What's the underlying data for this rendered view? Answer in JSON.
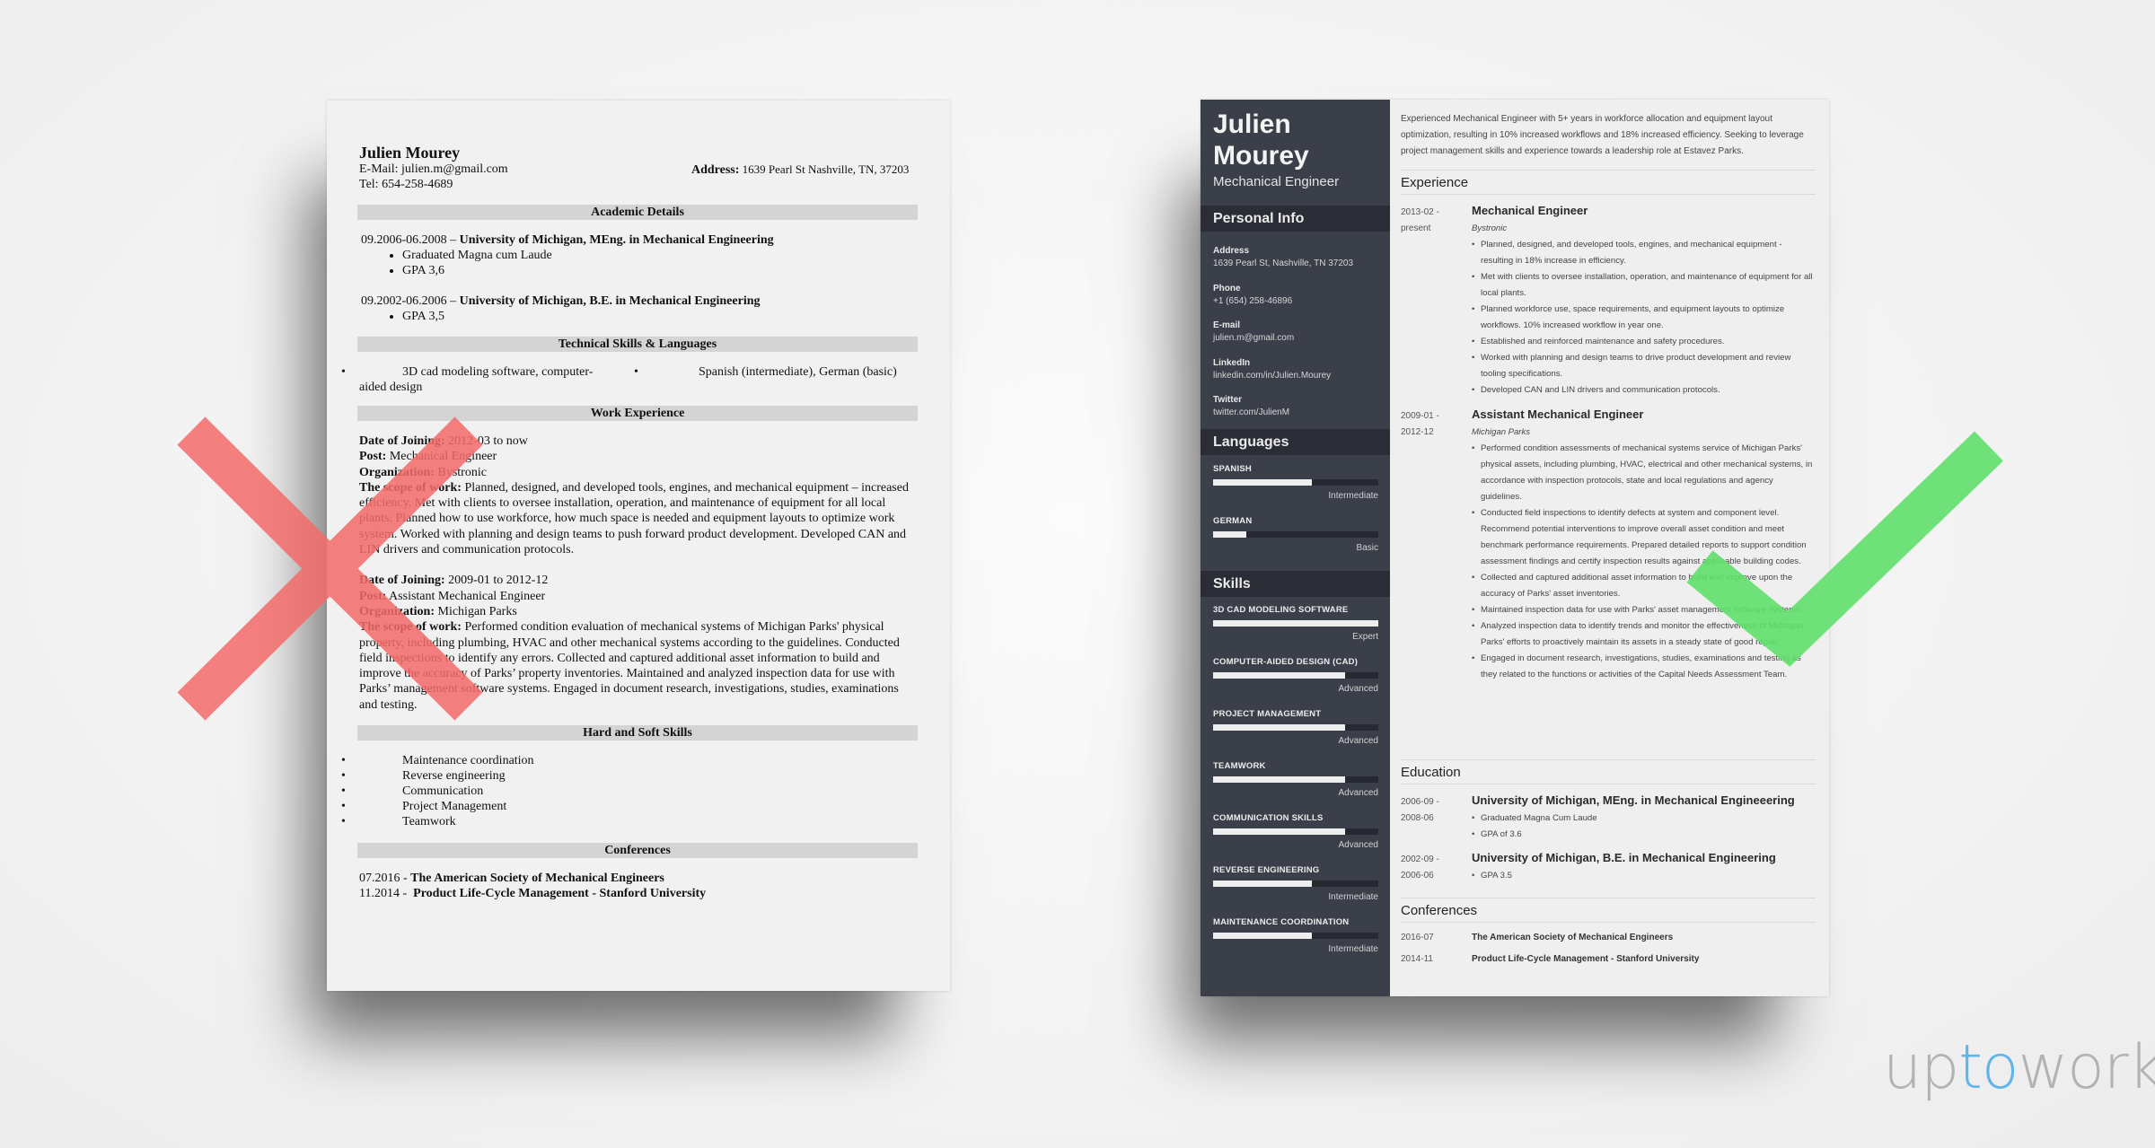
{
  "bad_resume": {
    "name": "Julien Mourey",
    "email": "E-Mail: julien.m@gmail.com",
    "tel": "Tel: 654-258-4689",
    "address_label": "Address:",
    "address_value": "1639 Pearl St Nashville, TN, 37203",
    "sections": {
      "academic": "Academic Details",
      "technical": "Technical Skills & Languages",
      "work": "Work Experience",
      "skills": "Hard and Soft Skills",
      "conferences": "Conferences"
    },
    "education": [
      {
        "dates": "09.2006-06.2008 – ",
        "title": "University of Michigan, MEng. in Mechanical Engineering",
        "bullets": [
          "Graduated Magna cum Laude",
          "GPA 3,6"
        ]
      },
      {
        "dates": "09.2002-06.2006 – ",
        "title": "University of Michigan, B.E. in Mechanical Engineering",
        "bullets": [
          "GPA 3,5"
        ]
      }
    ],
    "technical": [
      "3D cad modeling software, computer-aided design",
      "Spanish (intermediate), German (basic)"
    ],
    "work": [
      {
        "date_label": "Date of Joining:",
        "date": " 2012-03 to now",
        "post_label": "Post:",
        "post": " Mechanical Engineer",
        "org_label": "Organization:",
        "org": " Bystronic",
        "scope_label": "The scope of work:",
        "scope": " Planned, designed, and developed tools, engines, and mechanical equipment – increased efficiency. Met with clients to oversee installation, operation, and maintenance of equipment for all local plants. Planned how to use workforce, how much space is needed and equipment layouts to optimize work system. Worked with planning and design teams to push forward product development. Developed CAN and LIN drivers and communication protocols."
      },
      {
        "date_label": "Date of Joining:",
        "date": " 2009-01 to 2012-12",
        "post_label": "Post:",
        "post": " Assistant Mechanical Engineer",
        "org_label": "Organization:",
        "org": " Michigan Parks",
        "scope_label": "The scope of work:",
        "scope": " Performed condition evaluation of mechanical systems of Michigan Parks' physical property, including plumbing, HVAC and other mechanical systems according to the guidelines. Conducted field inspections to identify any errors. Collected and captured additional asset information to build and improve the accuracy of Parks’ property inventories. Maintained and analyzed inspection data for use with Parks’ management software systems. Engaged in document research, investigations, studies, examinations and testing."
      }
    ],
    "skills": [
      "Maintenance coordination",
      "Reverse engineering",
      "Communication",
      "Project Management",
      "Teamwork"
    ],
    "conferences": [
      {
        "date": "07.2016 - ",
        "title": "The American Society of Mechanical Engineers"
      },
      {
        "date": "11.2014 -  ",
        "title": "Product Life-Cycle Management - Stanford University"
      }
    ]
  },
  "good_resume": {
    "first_name": "Julien",
    "last_name": "Mourey",
    "job_title": "Mechanical Engineer",
    "personal_info_heading": "Personal Info",
    "personal_info": [
      {
        "label": "Address",
        "value": "1639 Pearl St, Nashville, TN 37203"
      },
      {
        "label": "Phone",
        "value": "+1 (654) 258-46896"
      },
      {
        "label": "E-mail",
        "value": "julien.m@gmail.com"
      },
      {
        "label": "LinkedIn",
        "value": "linkedin.com/in/Julien.Mourey"
      },
      {
        "label": "Twitter",
        "value": "twitter.com/JulienM"
      }
    ],
    "languages_heading": "Languages",
    "languages": [
      {
        "name": "SPANISH",
        "level": "Intermediate",
        "fraction": 0.6
      },
      {
        "name": "GERMAN",
        "level": "Basic",
        "fraction": 0.2
      }
    ],
    "skills_heading": "Skills",
    "skills": [
      {
        "name": "3D CAD MODELING SOFTWARE",
        "level": "Expert",
        "fraction": 1.0
      },
      {
        "name": "COMPUTER-AIDED DESIGN (CAD)",
        "level": "Advanced",
        "fraction": 0.8
      },
      {
        "name": "PROJECT MANAGEMENT",
        "level": "Advanced",
        "fraction": 0.8
      },
      {
        "name": "TEAMWORK",
        "level": "Advanced",
        "fraction": 0.8
      },
      {
        "name": "COMMUNICATION SKILLS",
        "level": "Advanced",
        "fraction": 0.8
      },
      {
        "name": "REVERSE ENGINEERING",
        "level": "Intermediate",
        "fraction": 0.6
      },
      {
        "name": "MAINTENANCE COORDINATION",
        "level": "Intermediate",
        "fraction": 0.6
      }
    ],
    "summary": "Experienced Mechanical Engineer with 5+ years in workforce allocation and equipment layout optimization, resulting in 10% increased workflows and 18% increased efficiency. Seeking to leverage project management skills and experience towards a leadership role at Estavez Parks.",
    "experience_heading": "Experience",
    "experience": [
      {
        "dates": "2013-02 - present",
        "role": "Mechanical Engineer",
        "org": "Bystronic",
        "bullets": [
          "Planned, designed, and developed tools, engines, and mechanical equipment - resulting in 18% increase in efficiency.",
          "Met with clients to oversee installation, operation, and maintenance of equipment for all local plants.",
          "Planned workforce use, space requirements, and equipment layouts to optimize workflows. 10% increased workflow in year one.",
          "Established and reinforced maintenance and safety procedures.",
          "Worked with planning and design teams to drive product development and review tooling specifications.",
          "Developed CAN and LIN drivers and communication protocols."
        ]
      },
      {
        "dates": "2009-01 - 2012-12",
        "role": "Assistant Mechanical Engineer",
        "org": "Michigan Parks",
        "bullets": [
          "Performed condition assessments of mechanical systems service of Michigan Parks' physical assets, including plumbing, HVAC, electrical and other mechanical systems, in accordance with inspection protocols, state and local regulations and agency guidelines.",
          "Conducted field inspections to identify defects at system and component level. Recommend potential interventions to improve overall asset condition and meet benchmark performance requirements. Prepared detailed reports to support condition assessment findings and certify inspection results against applicable building codes.",
          "Collected and captured additional asset information to build and improve upon the accuracy of Parks' asset inventories.",
          "Maintained inspection data for use with Parks' asset management software systems.",
          "Analyzed inspection data to identify trends and monitor the effectiveness of Michigan Parks' efforts to proactively maintain its assets in a steady state of good repair.",
          "Engaged in document research, investigations, studies, examinations and testing as they related to the functions or activities of the Capital Needs Assessment Team."
        ]
      }
    ],
    "education_heading": "Education",
    "education": [
      {
        "dates": "2006-09 - 2008-06",
        "title": "University of Michigan, MEng. in Mechanical Engineeering",
        "bullets": [
          "Graduated Magna Cum Laude",
          "GPA of 3.6"
        ]
      },
      {
        "dates": "2002-09 - 2006-06",
        "title": "University of Michigan, B.E. in Mechanical Engineering",
        "bullets": [
          "GPA 3.5"
        ]
      }
    ],
    "conferences_heading": "Conferences",
    "conferences": [
      {
        "date": "2016-07",
        "title": "The American Society of Mechanical Engineers"
      },
      {
        "date": "2014-11",
        "title": "Product Life-Cycle Management - Stanford University"
      }
    ]
  },
  "marks": {
    "bad_icon": "cross-mark-icon",
    "good_icon": "check-mark-icon",
    "bad_color": "#f46b6b",
    "good_color": "#5fe06a"
  },
  "logo": {
    "prefix": "up",
    "accent": "to",
    "suffix": "work",
    "gray": "#b2b2b2",
    "accent_color": "#5fb4ec"
  }
}
